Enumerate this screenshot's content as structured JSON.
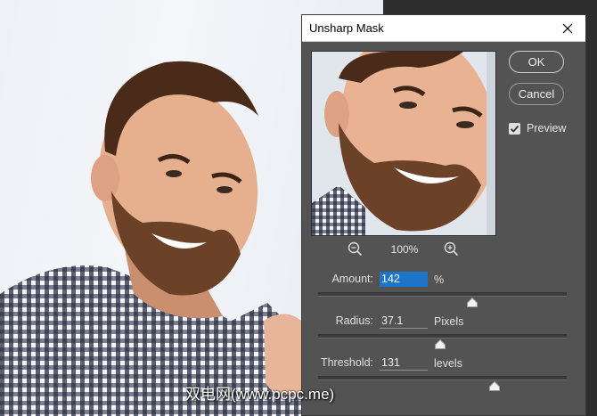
{
  "dialog": {
    "title": "Unsharp Mask",
    "ok_label": "OK",
    "cancel_label": "Cancel",
    "preview_label": "Preview",
    "preview_checked": true,
    "zoom_level": "100%",
    "params": {
      "amount": {
        "label": "Amount:",
        "value": "142",
        "unit": "%",
        "slider_fraction": 0.62
      },
      "radius": {
        "label": "Radius:",
        "value": "37.1",
        "unit": "Pixels",
        "slider_fraction": 0.49
      },
      "threshold": {
        "label": "Threshold:",
        "value": "131",
        "unit": "levels",
        "slider_fraction": 0.71
      }
    }
  },
  "watermark": "双电网(www.pcpc.me)",
  "colors": {
    "dialog_bg": "#535353",
    "selection": "#1e74c9",
    "canvas_bg": "#2d2d2d"
  }
}
